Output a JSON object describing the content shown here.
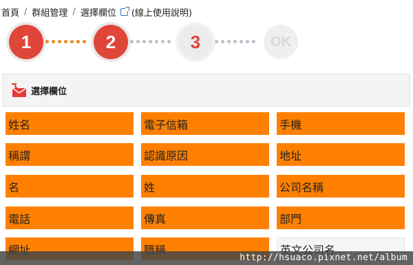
{
  "breadcrumb": {
    "home": "首頁",
    "group_manage": "群組管理",
    "current": "選擇欄位",
    "help": "(線上使用說明)"
  },
  "steps": [
    {
      "label": "1",
      "state": "active"
    },
    {
      "label": "2",
      "state": "active"
    },
    {
      "label": "3",
      "state": "pending"
    },
    {
      "label": "OK",
      "state": "pending"
    }
  ],
  "panel": {
    "title": "選擇欄位"
  },
  "fields": [
    {
      "label": "姓名",
      "selected": true
    },
    {
      "label": "電子信箱",
      "selected": true
    },
    {
      "label": "手機",
      "selected": true
    },
    {
      "label": "稱謂",
      "selected": true
    },
    {
      "label": "認識原因",
      "selected": true
    },
    {
      "label": "地址",
      "selected": true
    },
    {
      "label": "名",
      "selected": true
    },
    {
      "label": "姓",
      "selected": true
    },
    {
      "label": "公司名稱",
      "selected": true
    },
    {
      "label": "電話",
      "selected": true
    },
    {
      "label": "傳真",
      "selected": true
    },
    {
      "label": "部門",
      "selected": true
    },
    {
      "label": "網址",
      "selected": true
    },
    {
      "label": "職稱",
      "selected": true
    },
    {
      "label": "英文公司名",
      "selected": false
    }
  ],
  "watermark": "http://hsuaco.pixnet.net/album",
  "colors": {
    "accent": "#e0453a",
    "selected_field": "#ff8000",
    "progress_dots": "#f08a1c"
  },
  "icons": {
    "link": "external-link-icon",
    "panel": "mail-icon"
  }
}
